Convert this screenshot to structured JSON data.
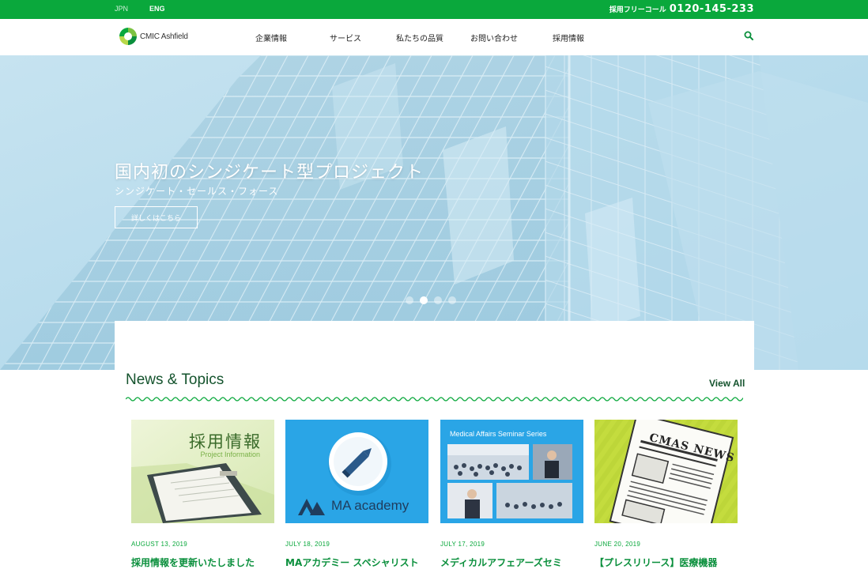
{
  "topbar": {
    "lang_jp": "JPN",
    "lang_en": "ENG",
    "freecall_label": "採用フリーコール",
    "freecall_number": "0120-145-233"
  },
  "nav": {
    "logo_text": "CMIC Ashfield",
    "items": [
      "企業情報",
      "サービス",
      "私たちの品質",
      "お問い合わせ",
      "採用情報"
    ]
  },
  "hero": {
    "title": "国内初のシンジケート型プロジェクト",
    "subtitle": "シンジケート・セールス・フォース",
    "button": "詳しくはこちら",
    "slides": 4,
    "active_slide": 2
  },
  "news": {
    "heading": "News & Topics",
    "view_all": "View All",
    "items": [
      {
        "date": "AUGUST 13, 2019",
        "title": "採用情報を更新いたしました",
        "thumb_title": "採用情報",
        "thumb_subtitle": "Project Information"
      },
      {
        "date": "JULY 18, 2019",
        "title": "MAアカデミー スペシャリスト",
        "thumb_title": "MA academy"
      },
      {
        "date": "JULY 17, 2019",
        "title": "メディカルアフェアーズセミ",
        "thumb_title": "Medical Affairs Seminar Series"
      },
      {
        "date": "JUNE 20, 2019",
        "title": "【プレスリリース】医療機器",
        "thumb_title": "CMAS NEWS"
      }
    ]
  },
  "colors": {
    "brand_green": "#0aa83c",
    "dark_green": "#14532d",
    "hero_sky": "#b9dbeb"
  }
}
